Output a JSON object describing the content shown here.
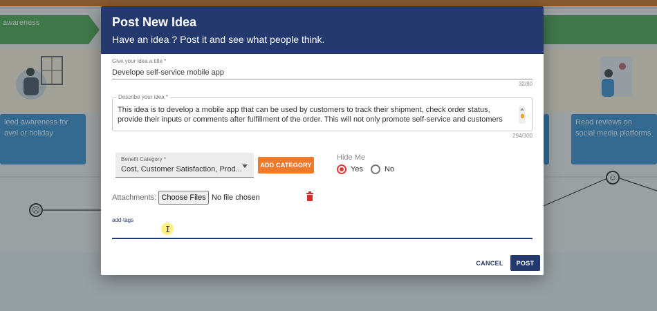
{
  "background": {
    "stage_label": "awareness",
    "card_left_text": "leed awareness for avel or holiday",
    "card_right_text": "Read reviews on social media platforms"
  },
  "dialog": {
    "title": "Post New Idea",
    "subtitle": "Have an idea ? Post it and see what people think.",
    "title_field": {
      "label": "Give your idea a title *",
      "value": "Develope self-service mobile app",
      "counter": "32/80"
    },
    "description_field": {
      "label": "Describe your idea *",
      "value": "This idea is to develop a mobile app that can be used by customers to track their shipment, check order status, provide their inputs or comments after fulfillment of the order. This will not only promote self-service and customers will feel",
      "counter": "294/300"
    },
    "benefit_category": {
      "label": "Benefit Category *",
      "value": "Cost, Customer Satisfaction, Prod..."
    },
    "add_category_label": "ADD CATEGORY",
    "hide_me": {
      "label": "Hide Me",
      "options": [
        "Yes",
        "No"
      ],
      "selected": "Yes"
    },
    "attachments": {
      "label": "Attachments:",
      "button_label": "Choose Files",
      "status": "No file chosen"
    },
    "tags": {
      "label": "add-tags",
      "value": ""
    },
    "cancel_label": "CANCEL",
    "post_label": "POST"
  },
  "colors": {
    "header": "#243a6e",
    "accent_orange": "#f07a2a",
    "radio_selected": "#e53935",
    "delete_icon": "#d32f2f"
  }
}
